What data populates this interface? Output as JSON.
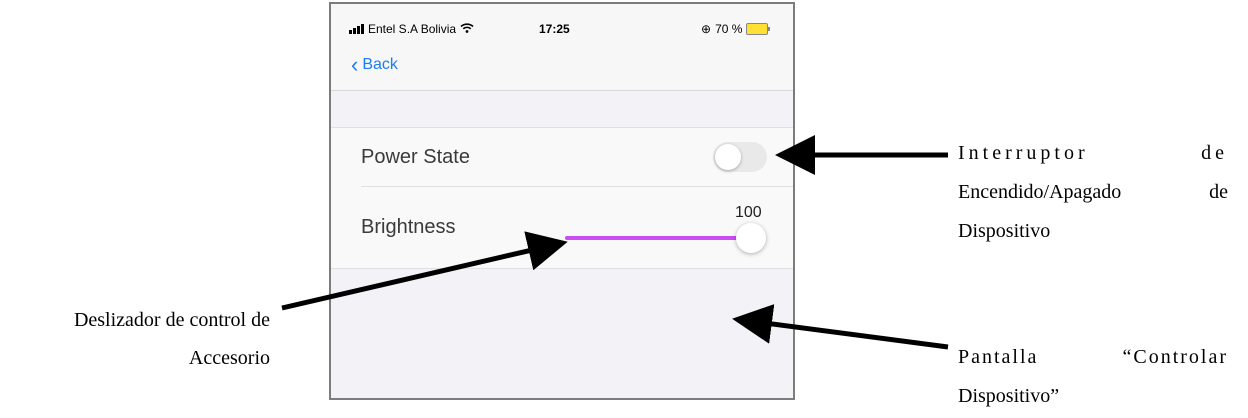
{
  "status_bar": {
    "carrier": "Entel S.A Bolivia",
    "time": "17:25",
    "battery": "70 %"
  },
  "nav": {
    "back_label": "Back"
  },
  "rows": {
    "power_state": {
      "label": "Power State",
      "value": false
    },
    "brightness": {
      "label": "Brightness",
      "value": "100",
      "level": 1.0
    }
  },
  "colors": {
    "accent": "#1a7cf5",
    "slider": "#c94df2",
    "background": "#f2f2f7"
  },
  "annotations": {
    "switch_line1": "Interruptor de",
    "switch_line2": "Encendido/Apagado de",
    "switch_line3": "Dispositivo",
    "slider_line1": "Deslizador de control de",
    "slider_line2": "Accesorio",
    "screen_line1": "Pantalla “Controlar",
    "screen_line2": "Dispositivo”"
  }
}
